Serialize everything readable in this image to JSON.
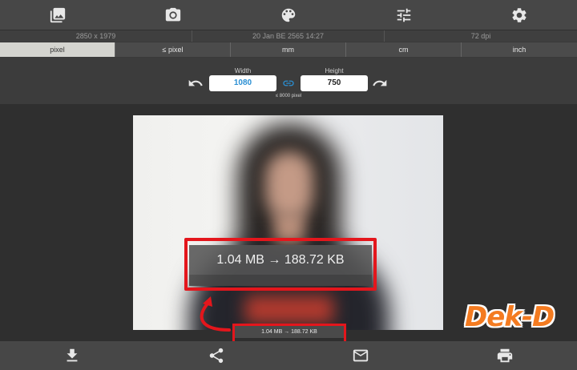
{
  "toolbar": {
    "icons": [
      "gallery-icon",
      "camera-icon",
      "palette-icon",
      "adjust-sliders-icon",
      "settings-gear-icon"
    ]
  },
  "info": {
    "resolution": "2850 x 1979",
    "date": "20 Jan BE 2565 14:27",
    "dpi": "72 dpi"
  },
  "units": {
    "tabs": [
      "pixel",
      "≤ pixel",
      "mm",
      "cm",
      "inch"
    ],
    "active": "pixel"
  },
  "dimensions": {
    "width_label": "Width",
    "width_value": "1080",
    "height_label": "Height",
    "height_value": "750",
    "limit_note": "≤ 8000 pixel"
  },
  "size": {
    "main": "1.04 MB  →  188.72 KB",
    "mini": "1.04 MB  →  188.72 KB"
  },
  "watermark": {
    "logo_text": "Dek-D"
  },
  "colors": {
    "highlight": "#e4161c",
    "width_value": "#2a8fd3",
    "logo": "#f47b20"
  },
  "bottombar": {
    "icons": [
      "download-icon",
      "share-icon",
      "mail-icon",
      "print-icon"
    ]
  }
}
